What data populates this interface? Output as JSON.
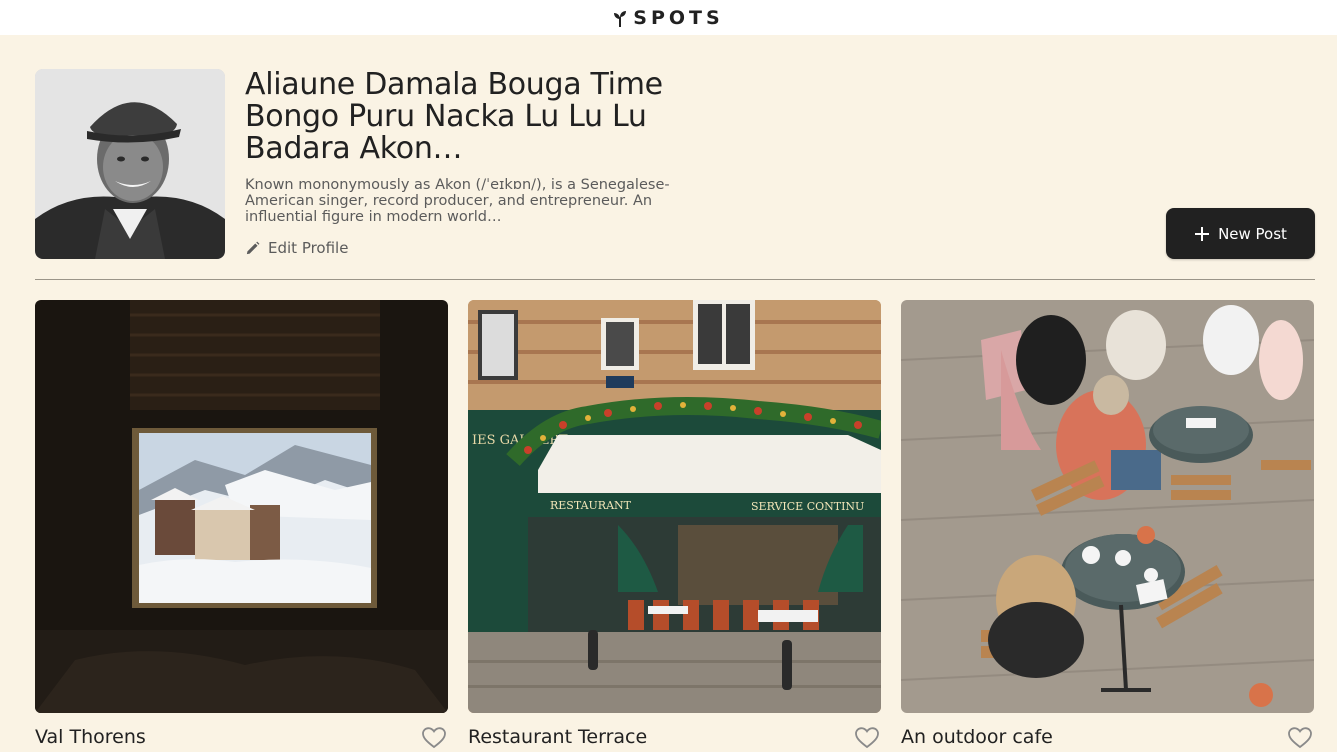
{
  "app": {
    "logo_text": "SPOTS",
    "logo_icon": "sprout-icon"
  },
  "profile": {
    "name": "Aliaune Damala Bouga Time Bongo Puru Nacka Lu Lu Lu Badara Akon…",
    "bio": "Known mononymously as Akon (/ˈeɪkɒn/), is a Senegalese-American singer, record producer, and entrepreneur. An influential figure in modern world…",
    "edit_label": "Edit Profile",
    "edit_icon": "pencil-icon",
    "avatar_icon": "avatar-photo"
  },
  "actions": {
    "new_post_label": "New Post",
    "new_post_icon": "plus-icon"
  },
  "cards": [
    {
      "title": "Val Thorens",
      "image": "snowy-mountain-window-photo",
      "liked": false,
      "like_icon": "heart-outline-icon"
    },
    {
      "title": "Restaurant Terrace",
      "image": "paris-restaurant-photo",
      "liked": false,
      "like_icon": "heart-outline-icon",
      "sign_left": "RESTAURANT",
      "sign_right": "SERVICE CONTINU",
      "facade_text": "IES GAUBERT"
    },
    {
      "title": "An outdoor cafe",
      "image": "outdoor-cafe-photo",
      "liked": false,
      "like_icon": "heart-outline-icon"
    }
  ],
  "colors": {
    "page_background": "#FAF3E4",
    "header_background": "#FFFFFF",
    "text": "#212121",
    "muted_text": "#5b5b5b",
    "button_background": "#212121"
  }
}
